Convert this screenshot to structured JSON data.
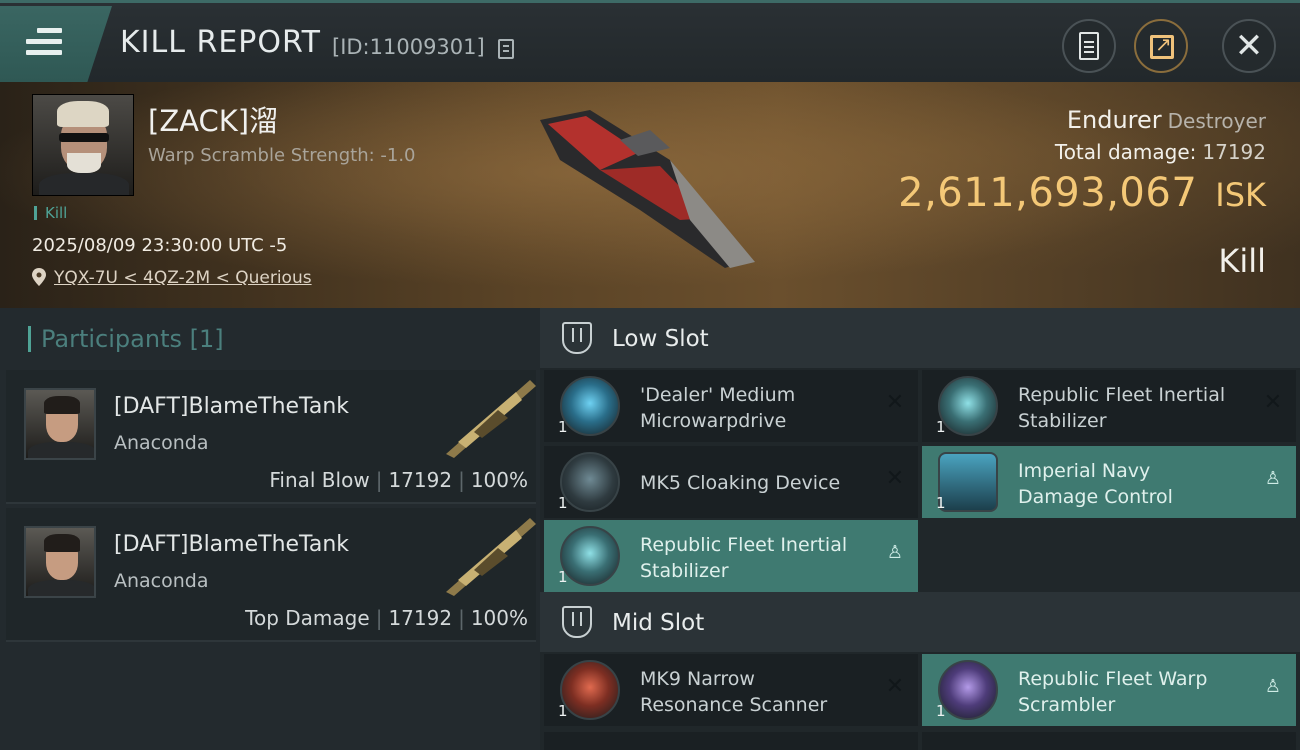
{
  "header": {
    "title": "KILL REPORT",
    "report_id": "[ID:11009301]",
    "icons": {
      "menu": "hamburger-menu-icon",
      "copy": "copy-icon",
      "clipboard": "clipboard-icon",
      "share": "share-icon",
      "close": "close-icon"
    }
  },
  "victim": {
    "name": "[ZACK]溜",
    "warp_scramble": "Warp Scramble Strength: -1.0",
    "tag": "Kill",
    "timestamp": "2025/08/09 23:30:00 UTC -5",
    "location": "YQX-7U < 4QZ-2M < Querious",
    "ship_name": "Endurer",
    "ship_class": "Destroyer",
    "total_damage_label": "Total damage:",
    "total_damage": "17192",
    "isk_value": "2,611,693,067",
    "isk_unit": "ISK",
    "result": "Kill"
  },
  "participants": {
    "label": "Participants",
    "count": "[1]",
    "rows": [
      {
        "name": "[DAFT]BlameTheTank",
        "ship": "Anaconda",
        "role": "Final Blow",
        "damage": "17192",
        "percent": "100%"
      },
      {
        "name": "[DAFT]BlameTheTank",
        "ship": "Anaconda",
        "role": "Top Damage",
        "damage": "17192",
        "percent": "100%"
      }
    ]
  },
  "fitting": {
    "low_slot": {
      "title": "Low Slot",
      "modules": [
        {
          "name_line1": "'Dealer' Medium",
          "name_line2": "Microwarpdrive",
          "qty": "1",
          "status": "destroyed"
        },
        {
          "name_line1": "Republic Fleet Inertial",
          "name_line2": "Stabilizer",
          "qty": "1",
          "status": "destroyed"
        },
        {
          "name_line1": "MK5 Cloaking Device",
          "name_line2": "",
          "qty": "1",
          "status": "destroyed"
        },
        {
          "name_line1": "Imperial Navy",
          "name_line2": "Damage Control",
          "qty": "1",
          "status": "dropped"
        },
        {
          "name_line1": "Republic Fleet Inertial",
          "name_line2": "Stabilizer",
          "qty": "1",
          "status": "dropped"
        }
      ]
    },
    "mid_slot": {
      "title": "Mid Slot",
      "modules": [
        {
          "name_line1": "MK9 Narrow",
          "name_line2": "Resonance Scanner",
          "qty": "1",
          "status": "destroyed"
        },
        {
          "name_line1": "Republic Fleet Warp",
          "name_line2": "Scrambler",
          "qty": "1",
          "status": "dropped"
        }
      ]
    },
    "status_glyphs": {
      "destroyed": "✕",
      "dropped": "♙"
    }
  },
  "colors": {
    "accent_teal": "#4fa396",
    "isk_gold": "#f4c877",
    "dropped_bg": "#3f7a71"
  }
}
